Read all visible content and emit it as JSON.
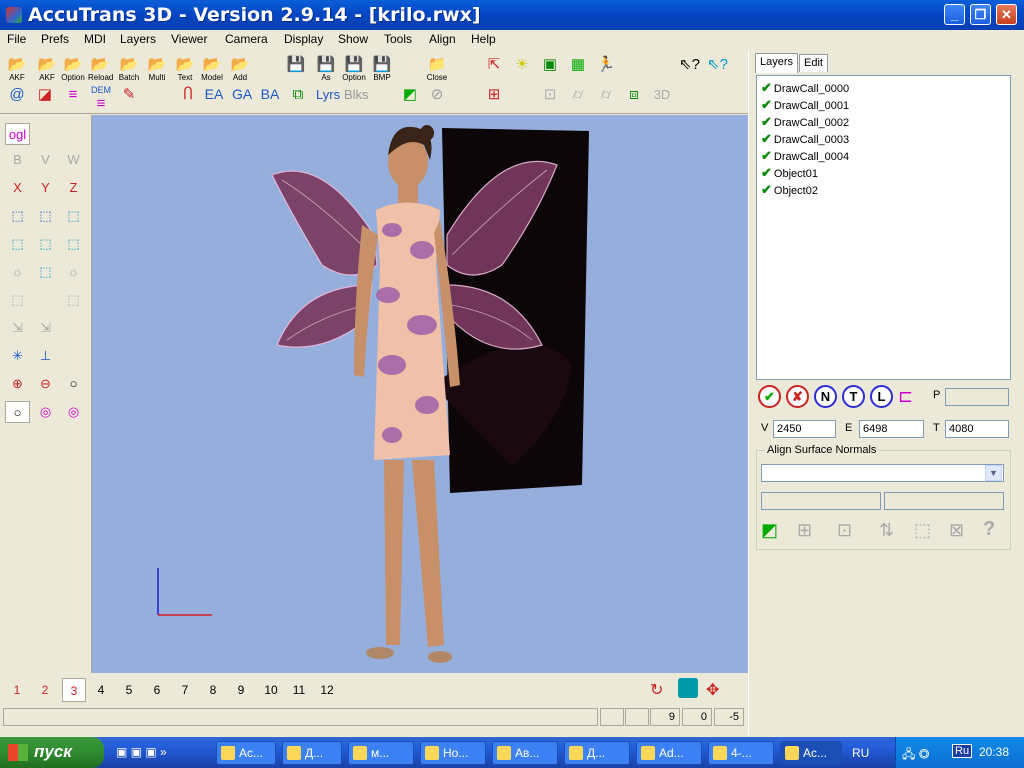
{
  "window": {
    "title": "AccuTrans 3D - Version 2.9.14 - [krilo.rwx]"
  },
  "menu": [
    "File",
    "Prefs",
    "MDI",
    "Layers",
    "Viewer",
    "Camera",
    "Display",
    "Show",
    "Tools",
    "Align",
    "Help"
  ],
  "toolbar1": [
    {
      "icon": "folder-open-icon",
      "label": "AKF"
    },
    {
      "icon": "folder-open-icon",
      "label": "Option"
    },
    {
      "icon": "folder-open-icon",
      "label": "Reload"
    },
    {
      "icon": "folder-open-icon",
      "label": "Batch"
    },
    {
      "icon": "folder-open-icon",
      "label": "Multi"
    },
    {
      "icon": "folder-open-icon",
      "label": "Text"
    },
    {
      "icon": "folder-open-icon",
      "label": "Model"
    },
    {
      "icon": "folder-open-icon",
      "label": "Add"
    },
    {
      "icon": "save-icon",
      "label": ""
    },
    {
      "icon": "save-icon",
      "label": "As"
    },
    {
      "icon": "save-icon",
      "label": "Option"
    },
    {
      "icon": "save-icon",
      "label": "BMP"
    },
    {
      "icon": "folder-close-icon",
      "label": "Close"
    }
  ],
  "toolbar2_text": {
    "dem": "DEM",
    "ea": "EA",
    "ga": "GA",
    "ba": "BA",
    "lyrs": "Lyrs",
    "blks": "Blks",
    "d3": "3D"
  },
  "left_tools": {
    "ogl": "ogl",
    "b": "B",
    "v": "V",
    "w": "W",
    "x": "X",
    "y": "Y",
    "z": "Z"
  },
  "viewport": {
    "background": "#95aedc"
  },
  "pages": [
    "1",
    "2",
    "3",
    "4",
    "5",
    "6",
    "7",
    "8",
    "9",
    "10",
    "11",
    "12"
  ],
  "active_page": "3",
  "status": {
    "c1": "9",
    "c2": "0",
    "c3": "-5"
  },
  "tabs": {
    "layers": "Layers",
    "edit": "Edit"
  },
  "layers": [
    "DrawCall_0000",
    "DrawCall_0001",
    "DrawCall_0002",
    "DrawCall_0003",
    "DrawCall_0004",
    "Object01",
    "Object02"
  ],
  "layer_buttons": {
    "n": "N",
    "t": "T",
    "l": "L"
  },
  "p_label": "P",
  "counts": {
    "v_label": "V",
    "v": "2450",
    "e_label": "E",
    "e": "6498",
    "t_label": "T",
    "t": "4080"
  },
  "align": {
    "label": "Align Surface Normals"
  },
  "taskbar": {
    "start": "пуск",
    "items": [
      "Ac...",
      "Д...",
      "м...",
      "Но...",
      "Ав...",
      "Д...",
      "Ad...",
      "4-...",
      "Ac..."
    ],
    "lang": "RU",
    "clock": "20:38",
    "tray_lang": "Ru"
  }
}
